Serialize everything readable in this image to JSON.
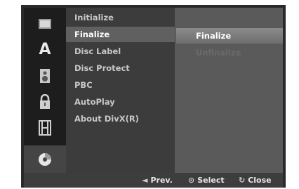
{
  "sidebar": {
    "icons": [
      {
        "name": "disc-settings-icon"
      },
      {
        "name": "language-icon",
        "glyph": "A"
      },
      {
        "name": "audio-speaker-icon"
      },
      {
        "name": "lock-icon"
      },
      {
        "name": "recording-film-icon"
      },
      {
        "name": "disc-icon"
      }
    ]
  },
  "menu": {
    "items": [
      {
        "label": "Initialize"
      },
      {
        "label": "Finalize"
      },
      {
        "label": "Disc Label"
      },
      {
        "label": "Disc Protect"
      },
      {
        "label": "PBC"
      },
      {
        "label": "AutoPlay"
      },
      {
        "label": "About DivX(R)"
      }
    ],
    "selected": "Finalize"
  },
  "submenu": {
    "items": [
      {
        "label": "Finalize",
        "state": "selected"
      },
      {
        "label": "Unfinalize",
        "state": "disabled"
      }
    ]
  },
  "footer": {
    "prev": {
      "glyph": "◄",
      "label": "Prev."
    },
    "select": {
      "glyph": "⊙",
      "label": "Select"
    },
    "close": {
      "glyph": "↻",
      "label": "Close"
    }
  },
  "colors": {
    "background": "#2a2a2a",
    "menu_selected": "#606060",
    "submenu": "#5a5a5a",
    "disabled_text": "#6a6a6a"
  }
}
